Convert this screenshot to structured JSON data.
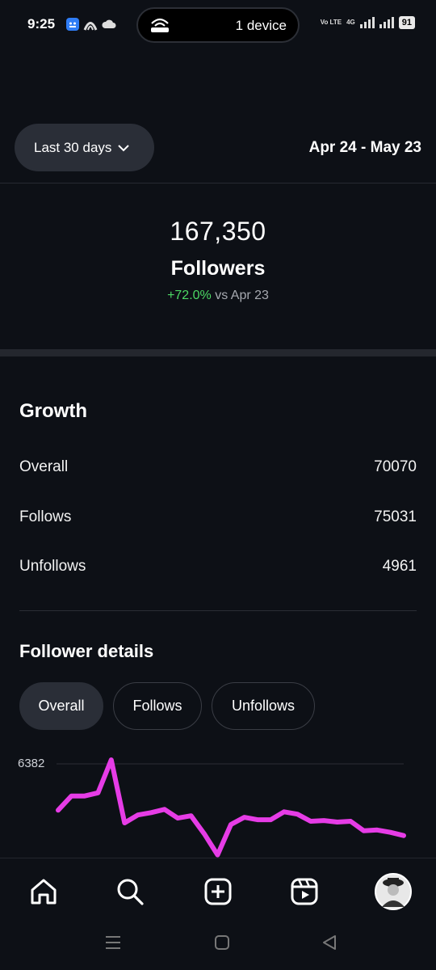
{
  "status_bar": {
    "time": "9:25",
    "hotspot_text": "1 device",
    "network_line1": "Vo LTE",
    "network_4g": "4G",
    "battery": "91"
  },
  "header": {
    "range_label": "Last 30 days",
    "date_range": "Apr 24 - May 23"
  },
  "summary": {
    "count": "167,350",
    "label": "Followers",
    "change": "+72.0%",
    "change_suffix": " vs Apr 23",
    "change_color": "#4cd964"
  },
  "growth": {
    "title": "Growth",
    "rows": [
      {
        "label": "Overall",
        "value": "70070"
      },
      {
        "label": "Follows",
        "value": "75031"
      },
      {
        "label": "Unfollows",
        "value": "4961"
      }
    ]
  },
  "details": {
    "title": "Follower details",
    "chips": [
      {
        "label": "Overall",
        "active": true
      },
      {
        "label": "Follows",
        "active": false
      },
      {
        "label": "Unfollows",
        "active": false
      }
    ]
  },
  "chart_data": {
    "type": "line",
    "y_tick_label": "6382",
    "color": "#e63ce6",
    "values": [
      3200,
      4100,
      4100,
      4300,
      6382,
      2400,
      2900,
      3050,
      3250,
      2700,
      2850,
      1700,
      380,
      2300,
      2750,
      2600,
      2600,
      3100,
      2950,
      2500,
      2550,
      2450,
      2500,
      1900,
      1950,
      1800,
      1600
    ]
  },
  "bottom_nav": {
    "items": [
      "home-icon",
      "search-icon",
      "create-icon",
      "reels-icon",
      "profile-avatar"
    ]
  }
}
